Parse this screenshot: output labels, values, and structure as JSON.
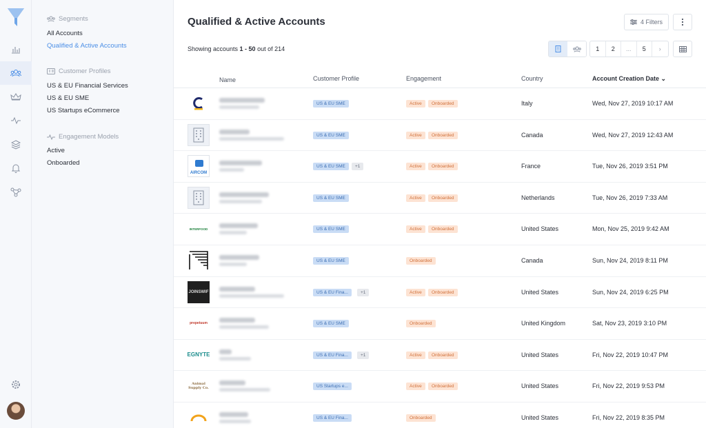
{
  "sidebar": {
    "segments_heading": "Segments",
    "segments": [
      "All Accounts",
      "Qualified & Active Accounts"
    ],
    "profiles_heading": "Customer Profiles",
    "profiles": [
      "US & EU Financial Services",
      "US & EU SME",
      "US Startups eCommerce"
    ],
    "engagement_heading": "Engagement Models",
    "engagement": [
      "Active",
      "Onboarded"
    ]
  },
  "header": {
    "title": "Qualified & Active Accounts",
    "filters_label": "4 Filters"
  },
  "summary": {
    "prefix": "Showing accounts ",
    "range": "1 - 50",
    "middle": " out of ",
    "total": "214"
  },
  "pagination": [
    "1",
    "2",
    "...",
    "5",
    "›"
  ],
  "table": {
    "columns": [
      "Name",
      "Customer Profile",
      "Engagement",
      "Country",
      "Account Creation Date ⌄"
    ],
    "rows": [
      {
        "logo": "C",
        "profile": "US & EU SME",
        "plus": "",
        "engagement": [
          "Active",
          "Onboarded"
        ],
        "country": "Italy",
        "date": "Wed, Nov 27, 2019 10:17 AM"
      },
      {
        "logo": "building",
        "profile": "US & EU SME",
        "plus": "",
        "engagement": [
          "Active",
          "Onboarded"
        ],
        "country": "Canada",
        "date": "Wed, Nov 27, 2019 12:43 AM"
      },
      {
        "logo": "AIRCOM",
        "profile": "US & EU SME",
        "plus": "+1",
        "engagement": [
          "Active",
          "Onboarded"
        ],
        "country": "France",
        "date": "Tue, Nov 26, 2019 3:51 PM"
      },
      {
        "logo": "building",
        "profile": "US & EU SME",
        "plus": "",
        "engagement": [
          "Active",
          "Onboarded"
        ],
        "country": "Netherlands",
        "date": "Tue, Nov 26, 2019 7:33 AM"
      },
      {
        "logo": "INTERFOOD",
        "profile": "US & EU SME",
        "plus": "",
        "engagement": [
          "Active",
          "Onboarded"
        ],
        "country": "United States",
        "date": "Mon, Nov 25, 2019 9:42 AM"
      },
      {
        "logo": "lines",
        "profile": "US & EU SME",
        "plus": "",
        "engagement": [
          "Onboarded"
        ],
        "country": "Canada",
        "date": "Sun, Nov 24, 2019 8:11 PM"
      },
      {
        "logo": "JOINSWIF",
        "profile": "US & EU Fina...",
        "plus": "+1",
        "engagement": [
          "Active",
          "Onboarded"
        ],
        "country": "United States",
        "date": "Sun, Nov 24, 2019 6:25 PM"
      },
      {
        "logo": "prepetuum",
        "profile": "US & EU SME",
        "plus": "",
        "engagement": [
          "Onboarded"
        ],
        "country": "United Kingdom",
        "date": "Sat, Nov 23, 2019 3:10 PM"
      },
      {
        "logo": "EGNYTE",
        "profile": "US & EU Fina...",
        "plus": "+1",
        "engagement": [
          "Active",
          "Onboarded"
        ],
        "country": "United States",
        "date": "Fri, Nov 22, 2019 10:47 PM"
      },
      {
        "logo": "Animal Supply Co.",
        "profile": "US Startups e...",
        "plus": "",
        "engagement": [
          "Active",
          "Onboarded"
        ],
        "country": "United States",
        "date": "Fri, Nov 22, 2019 9:53 PM"
      },
      {
        "logo": "arc",
        "profile": "US & EU Fina...",
        "plus": "",
        "engagement": [
          "Onboarded"
        ],
        "country": "United States",
        "date": "Fri, Nov 22, 2019 8:35 PM"
      }
    ]
  },
  "colors": {
    "accent": "#4a8ee6",
    "profile_tag": "#c9dcf5",
    "engagement_tag": "#fde3d3"
  }
}
